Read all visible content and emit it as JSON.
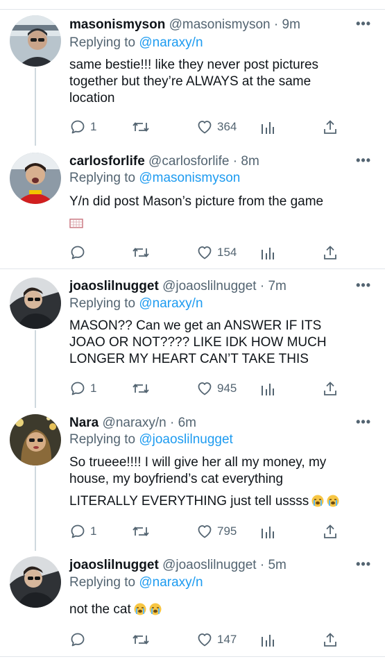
{
  "tweets": [
    {
      "name": "masonismyson",
      "handle": "@masonismyson",
      "time": "· 9m",
      "replying_prefix": "Replying to",
      "replying_to": "@naraxy/n",
      "text_lines": [
        "same bestie!!! like they never post pictures",
        "together but they’re ALWAYS at the same",
        "location"
      ],
      "replies": "1",
      "retweets": "",
      "likes": "364"
    },
    {
      "name": "carlosforlife",
      "handle": "@carlosforlife",
      "time": "· 8m",
      "replying_prefix": "Replying to",
      "replying_to": "@masonismyson",
      "text_lines": [
        "Y/n did post Mason’s picture from the game"
      ],
      "replies": "",
      "retweets": "",
      "likes": "154"
    },
    {
      "name": "joaoslilnugget",
      "handle": "@joaoslilnugget",
      "time": "· 7m",
      "replying_prefix": "Replying to",
      "replying_to": "@naraxy/n",
      "text_lines": [
        "MASON?? Can we get an ANSWER IF ITS",
        "JOAO OR NOT???? LIKE IDK HOW MUCH",
        "LONGER MY HEART CAN’T TAKE THIS"
      ],
      "replies": "1",
      "retweets": "",
      "likes": "945"
    },
    {
      "name": "Nara",
      "handle": "@naraxy/n",
      "time": "· 6m",
      "replying_prefix": "Replying to",
      "replying_to": "@joaoslilnugget",
      "text_lines": [
        "So trueee!!!! I will give her all my money, my",
        "house, my boyfriend’s cat everything",
        "LITERALLY EVERYTHING just tell ussss"
      ],
      "replies": "1",
      "retweets": "",
      "likes": "795"
    },
    {
      "name": "joaoslilnugget",
      "handle": "@joaoslilnugget",
      "time": "· 5m",
      "replying_prefix": "Replying to",
      "replying_to": "@naraxy/n",
      "text_lines": [
        "not the cat"
      ],
      "replies": "",
      "retweets": "",
      "likes": "147"
    }
  ],
  "icons": {
    "reply": "reply-icon",
    "retweet": "retweet-icon",
    "like": "heart-icon",
    "analytics": "analytics-icon",
    "share": "share-icon",
    "more": "more-icon",
    "emoji": "loudly-crying-face-emoji"
  },
  "colors": {
    "link": "#1d9bf0",
    "secondary": "#536471",
    "text": "#0f1419",
    "divider": "#e1e6ea"
  }
}
